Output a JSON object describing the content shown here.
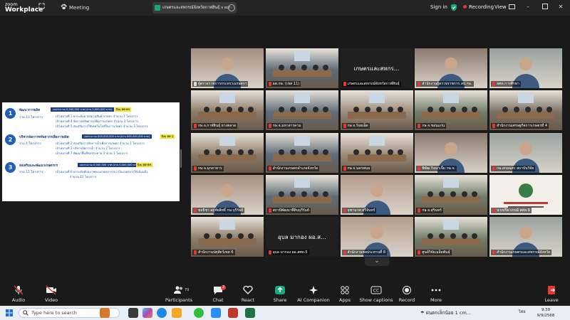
{
  "titlebar": {
    "logo_line1": "zoom",
    "logo_line2": "Workplace",
    "meeting_label": "Meeting",
    "share_tab_title": "เกษตรและสหกรณ์จังหวัดกาฬสินธุ์ s scr",
    "sign_in": "Sign in",
    "recording": "Recording",
    "view": "View",
    "colors": {
      "accent_green": "#2bd36a",
      "recording_red": "#e53935",
      "shield_green": "#1aa57a"
    }
  },
  "document": {
    "groups": [
      {
        "num": "1",
        "head": "พัฒนาการผลิต",
        "sub": "รวม 13 โครงการ",
        "budget": "งบประมาณ 0,000,000 บาท (ผ่าน 0,000,000 บาท)",
        "badge": "ปีงบ 68-69",
        "lines": [
          "เป้าหมายที่ 1 ยกระดับมาตรฐานสินค้าเกษตร จำนวน 7 โครงการ",
          "เป้าหมายที่ 4 จัดการทรัพยากรเพื่อการเกษตร จำนวน 3 โครงการ",
          "เป้าหมายที่ 5 ส่งเสริมการใช้เทคโนโลยีในการเกษตร จำนวน 3 โครงการ"
        ]
      },
      {
        "num": "2",
        "head": "บริหารจัดการทรัพยากรเพื่อการผลิต",
        "sub": "รวม 4 โครงการ",
        "budget": "งบประมาณ 000,000,000 บาท (ผ่าน 000,000,000 บาท)",
        "badge": "ปีงบ 68 1",
        "lines": [
          "เป้าหมายที่ 2 ส่งเสริมการจัดการน้ำเพื่อการเกษตร จำนวน 1 โครงการ",
          "เป้าหมายที่ 3 บริหารจัดการน้ำ จำนวน 2 โครงการ",
          "เป้าหมายที่ 7 พัฒนาพื้นที่ชลประทาน จำนวน 1 โครงการ"
        ]
      },
      {
        "num": "3",
        "head": "ส่งเสริมและพัฒนาเกษตรกร",
        "sub": "รวม 12 โครงการ",
        "budget": "งบประมาณ 0,000,000 บาท (ผ่าน 0,000,000 บาท)",
        "badge": "ปีงบ 68-69",
        "lines": [
          "เป้าหมายที่ 6 ยกระดับศักยภาพของเกษตรกร/สถาบันเกษตรกรให้เข้มแข็ง",
          "จำนวน 12 โครงการ"
        ]
      }
    ],
    "colors": {
      "navy": "#1a3d86",
      "blue": "#1f5fb5",
      "yellow": "#f9e21a"
    }
  },
  "gallery": {
    "tiles": [
      {
        "label": "ผู้ตรวจราชการกระทรวงเกษตรฯ",
        "scene": "person",
        "muted": false
      },
      {
        "label": "ผต.กษ. (เขต 11)",
        "scene": "room",
        "muted": true
      },
      {
        "label": "เกษตรและสหกรณ์จังหวัดกาฬสินธุ์",
        "scene": "name",
        "big": "เกษตรและสหกร...",
        "active": true,
        "muted": true
      },
      {
        "label": "สำนักงานผู้ตรวจราชการ สป.กษ.",
        "scene": "person",
        "muted": true
      },
      {
        "label": "สศท.การศึกษา",
        "scene": "person",
        "muted": true
      },
      {
        "label": "กษ.จ.กาฬสินธุ์ ยางตลาด",
        "scene": "room",
        "muted": true
      },
      {
        "label": "กษ.จ.มหาสารคาม",
        "scene": "room",
        "muted": true
      },
      {
        "label": "กษ.จ.ร้อยเอ็ด",
        "scene": "room",
        "muted": true
      },
      {
        "label": "กษ.จ.ขอนแก่น",
        "scene": "room",
        "muted": true
      },
      {
        "label": "สำนักงานเศรษฐกิจการเกษตรที่ 4",
        "scene": "room",
        "muted": true
      },
      {
        "label": "กษ.จ.มุกดาหาร",
        "scene": "room",
        "muted": true
      },
      {
        "label": "สำนักงานเกษตรอำเภอจังหวัด",
        "scene": "room",
        "muted": true
      },
      {
        "label": "กษ.จ.นครพนม",
        "scene": "room",
        "muted": true
      },
      {
        "label": "พิพัฒ กิจนาเจิ้ม กษ.จ.",
        "scene": "person",
        "muted": true
      },
      {
        "label": "กษ.สกลนคร สถาบันวิจัย",
        "scene": "person",
        "muted": true
      },
      {
        "label": "ชลธิชา อยู่ชัยสิทธิ์ กษ.บุรีรัมย์",
        "scene": "person",
        "muted": true
      },
      {
        "label": "สถานีพัฒนาที่ดินบุรีรัมย์",
        "scene": "room",
        "muted": true
      },
      {
        "label": "จุฑามาศ ศรีจันทร์",
        "scene": "person",
        "muted": true
      },
      {
        "label": "กษ.จ.สุรินทร์",
        "scene": "room",
        "muted": true
      },
      {
        "label": "นางปรียาภรณ์ สศท.9",
        "scene": "logo",
        "muted": true
      },
      {
        "label": "สำนักงานปศุสัตว์เขต 6",
        "scene": "room",
        "muted": true
      },
      {
        "label": "อุบล มากอง ผอ.สศท.5",
        "scene": "name",
        "big": "อุบล มากอง ผอ.ส...",
        "muted": true
      },
      {
        "label": "สำนักงานชลประทานที่ 8",
        "scene": "person",
        "muted": true
      },
      {
        "label": "ศูนย์วิจัยเมล็ดพันธุ์",
        "scene": "room",
        "muted": true
      },
      {
        "label": "สำนักงานเกษตรและสหกรณ์จังหวัด",
        "scene": "person",
        "muted": true
      }
    ]
  },
  "toolbar": {
    "audio": "Audio",
    "video": "Video",
    "participants": "Participants",
    "participants_count": "79",
    "chat": "Chat",
    "chat_badge": "2",
    "react": "React",
    "share": "Share",
    "ai_companion": "AI Companion",
    "apps": "Apps",
    "captions": "Show captions",
    "record": "Record",
    "more": "More",
    "leave": "Leave"
  },
  "taskbar": {
    "search_placeholder": "Type here to search",
    "weather": "ฝนตกเล็กน้อย 1 cm...",
    "lang": "ไทย",
    "time": "9:39",
    "date": "9/9/2568"
  }
}
